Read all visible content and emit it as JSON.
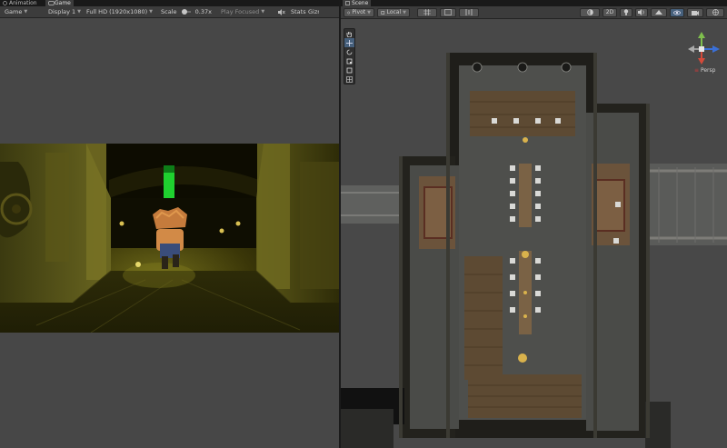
{
  "tabs": [
    {
      "label": "Animation",
      "icon": "animation-icon"
    },
    {
      "label": "Game",
      "icon": "game-icon"
    },
    {
      "label": "Scene",
      "icon": "scene-icon"
    }
  ],
  "game_toolbar": {
    "view": "Game",
    "display": "Display 1",
    "resolution": "Full HD (1920x1080)",
    "scale_label": "Scale",
    "scale_value": "0.37x",
    "play_focused": "Play Focused",
    "stats": "Stats",
    "gizmos": "Gizmos"
  },
  "scene_toolbar": {
    "pivot": "Pivot",
    "local": "Local",
    "mode_2d": "2D"
  },
  "scene": {
    "persp_label": "Persp"
  },
  "colors": {
    "accent": "#46607c",
    "panel": "#3c3c3c",
    "background": "#474747"
  }
}
